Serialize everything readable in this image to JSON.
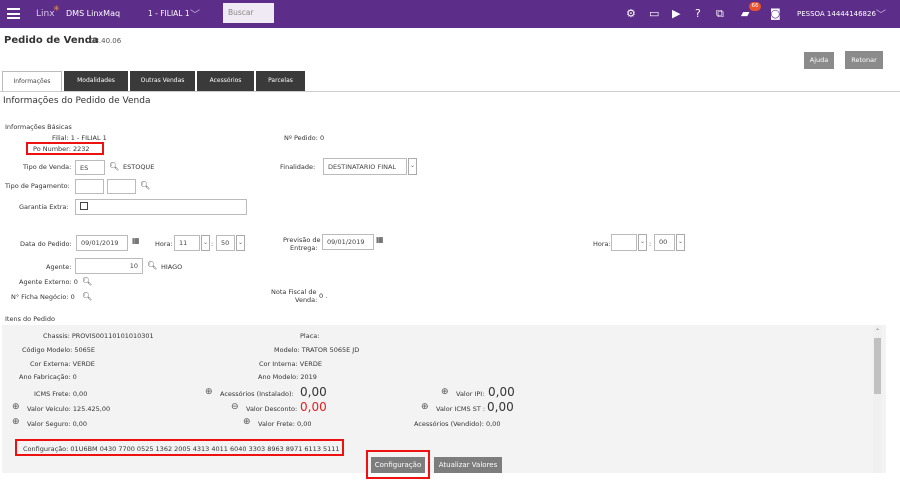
{
  "topbar": {
    "brand": "Linx",
    "app_name": "DMS LinxMaq",
    "filial": "1 - FILIAL 1",
    "search_placeholder": "Buscar",
    "notification_count": "66",
    "user": "PESSOA 14444146826",
    "accent_color": "#5d2d8a"
  },
  "page": {
    "title": "Pedido de Venda",
    "code": "08.40.06",
    "ajuda": "Ajuda",
    "retornar": "Retonar"
  },
  "tabs": [
    "Informações",
    "Modalidades",
    "Outras Vendas",
    "Acessórios",
    "Parcelas"
  ],
  "section_title": "Informações do Pedido de Venda",
  "basicas": {
    "heading": "Informações Básicas",
    "filial": "Filial: 1 - FILIAL 1",
    "po_number": "Po Number: 2232",
    "nr_pedido": "Nº Pedido: 0",
    "tipo_venda_label": "Tipo de Venda:",
    "tipo_venda_code": "ES",
    "tipo_venda_desc": "ESTOQUE",
    "finalidade_label": "Finalidade:",
    "finalidade_value": "DESTINATARIO FINAL",
    "tipo_pagamento_label": "Tipo de Pagamento:",
    "garantia_label": "Garantia Extra:",
    "data_pedido_label": "Data do Pedido:",
    "data_pedido": "09/01/2019",
    "hora_label": "Hora:",
    "hora": "11",
    "minuto": "50",
    "previsao_label_1": "Previsão de",
    "previsao_label_2": "Entrega:",
    "previsao": "09/01/2019",
    "hora2_label": "Hora:",
    "minuto2": "00",
    "agente_label": "Agente:",
    "agente_code": "10",
    "agente_name": "HIAGO",
    "agente_externo": "Agente Externo: 0",
    "ficha_negocio": "N° Ficha Negócio: 0",
    "nota_fiscal_label_1": "Nota Fiscal de",
    "nota_fiscal_label_2": "Venda:",
    "nota_fiscal_value": "0 ."
  },
  "itens": {
    "heading": "Itens do Pedido",
    "chassis": "Chassis: PROVIS00110101010301",
    "placa": "Placa:",
    "codigo_modelo": "Código Modelo: 5065E",
    "modelo": "Modelo: TRATOR 5065E JD",
    "cor_externa": "Cor Externa: VERDE",
    "cor_interna": "Cor Interna: VERDE",
    "ano_fabricacao": "Ano Fabricação: 0",
    "ano_modelo": "Ano Modelo: 2019",
    "icms_frete": "ICMS Frete: 0,00",
    "acessorios_instalado_label": "Acessórios (Instalado):",
    "acessorios_instalado": "0,00",
    "valor_ipi_label": "Valor IPI:",
    "valor_ipi": "0,00",
    "valor_veiculo": "Valor Veículo: 125.425,00",
    "valor_desconto_label": "Valor Desconto:",
    "valor_desconto": "0,00",
    "valor_icms_st_label": "Valor ICMS ST :",
    "valor_icms_st": "0,00",
    "valor_seguro": "Valor Seguro: 0,00",
    "valor_frete": "Valor Frete: 0,00",
    "acessorios_vendido": "Acessórios (Vendido): 0,00",
    "configuracao": "Configuração: 01U6BM 0430 7700 0525 1362 2005 4313 4011 6040 3303 8963 8971 6113 5111",
    "configuracao_button": "Configuração",
    "atualizar_button": "Atualizar Valores"
  }
}
